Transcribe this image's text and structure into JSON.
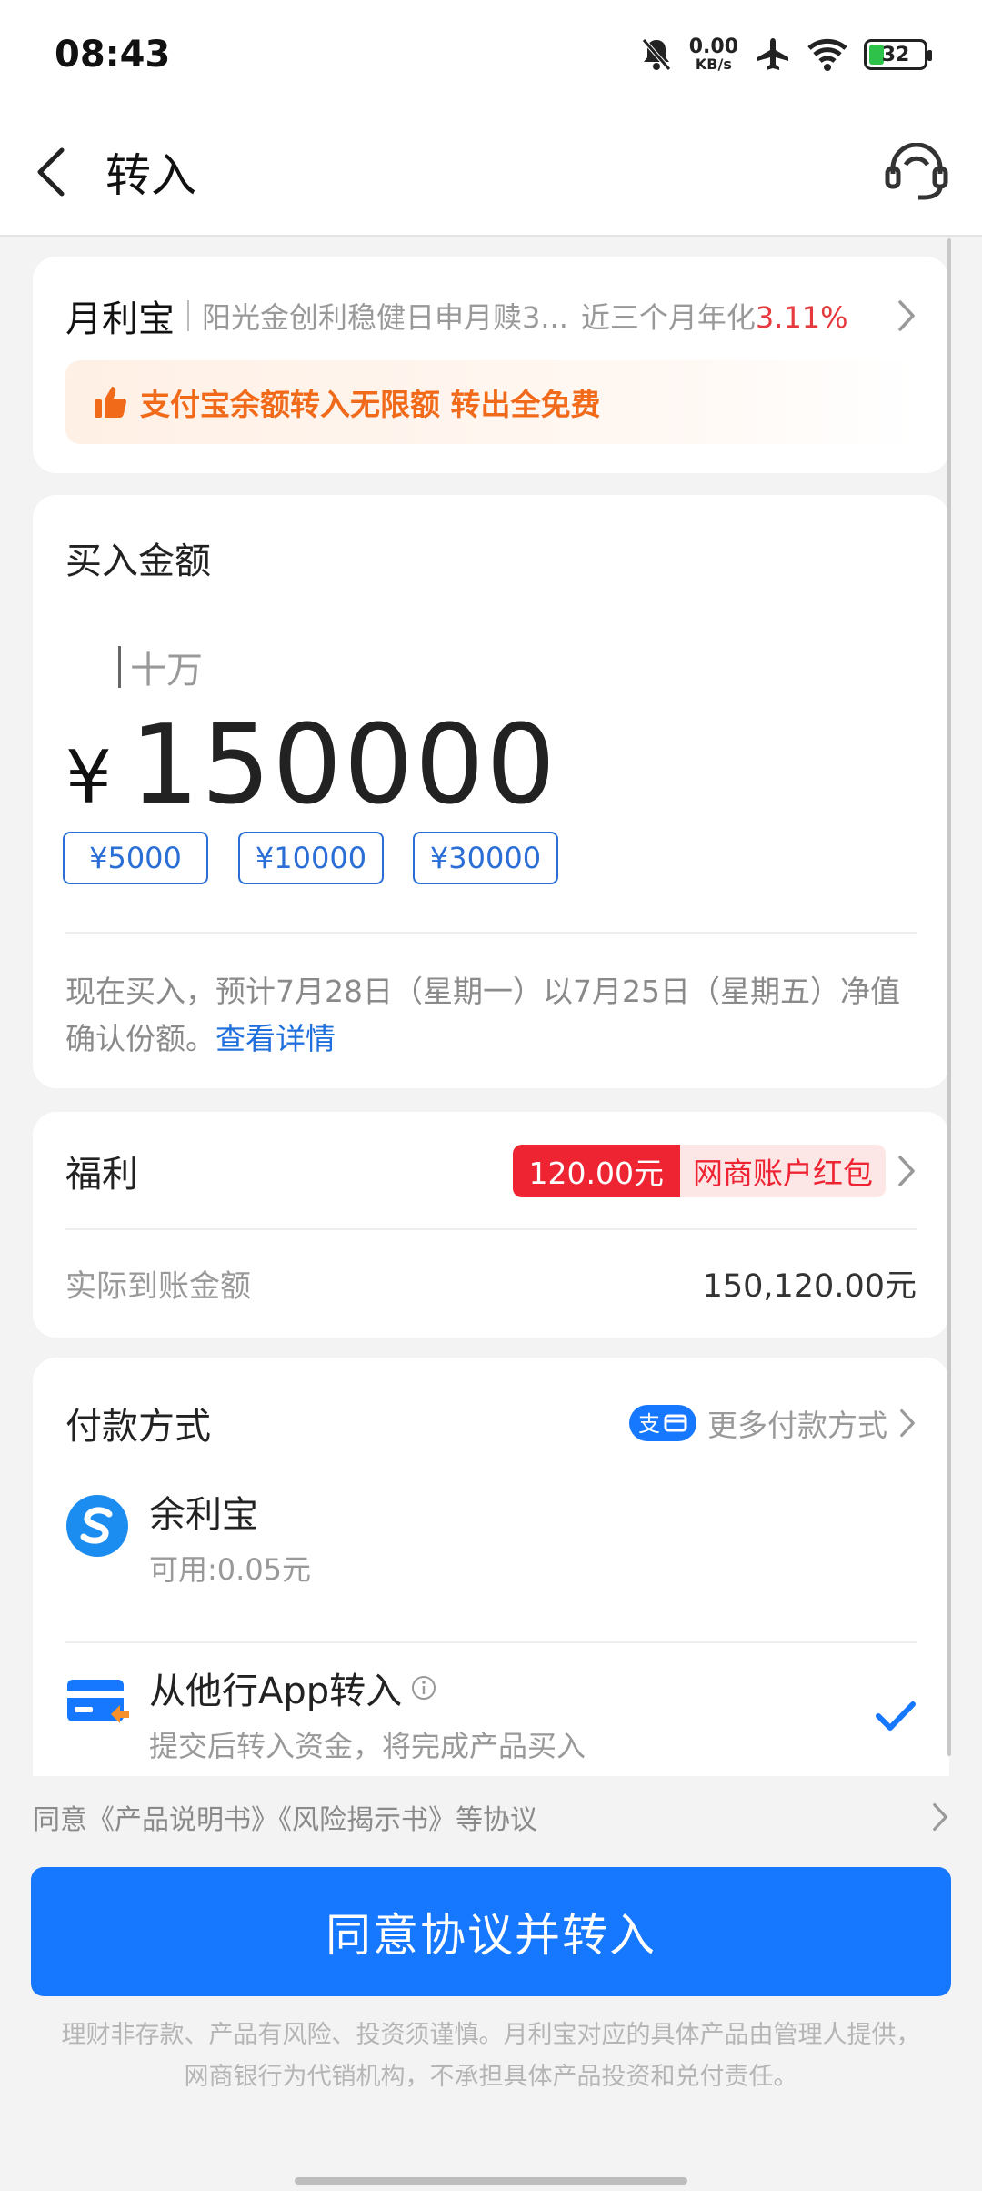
{
  "status_bar": {
    "time": "08:43",
    "net_speed_value": "0.00",
    "net_speed_unit": "KB/s",
    "battery": "32"
  },
  "nav": {
    "title": "转入"
  },
  "product": {
    "name": "月利宝",
    "fund": "阳光金创利稳健日申月赎3...",
    "yield_label": "近三个月年化",
    "yield_value": "3.11%",
    "promo": "支付宝余额转入无限额 转出全免费"
  },
  "purchase": {
    "title": "买入金额",
    "unit_hint": "十万",
    "currency": "¥",
    "amount": "150000",
    "quick_amounts": [
      "¥5000",
      "¥10000",
      "¥30000"
    ],
    "notice": "现在买入，预计7月28日（星期一）以7月25日（星期五）净值确认份额。",
    "notice_link": "查看详情"
  },
  "welfare": {
    "title": "福利",
    "tag_amount": "120.00元",
    "tag_text": "网商账户红包",
    "actual_label": "实际到账金额",
    "actual_value": "150,120.00元"
  },
  "payment": {
    "title": "付款方式",
    "more": "更多付款方式",
    "methods": [
      {
        "name": "余利宝",
        "sub": "可用:0.05元"
      },
      {
        "name": "从他行App转入",
        "sub": "提交后转入资金，将完成产品买入"
      }
    ]
  },
  "agreement": {
    "text": "同意《产品说明书》《风险揭示书》等协议"
  },
  "submit": {
    "label": "同意协议并转入"
  },
  "disclaimer": {
    "line1": "理财非存款、产品有风险、投资须谨慎。月利宝对应的具体产品由管理人提供，",
    "line2": "网商银行为代销机构，不承担具体产品投资和兑付责任。"
  },
  "colors": {
    "primary": "#1677ff",
    "accent_red": "#ee2433",
    "promo_orange": "#f16a1a",
    "link_blue": "#1f6fdc"
  }
}
